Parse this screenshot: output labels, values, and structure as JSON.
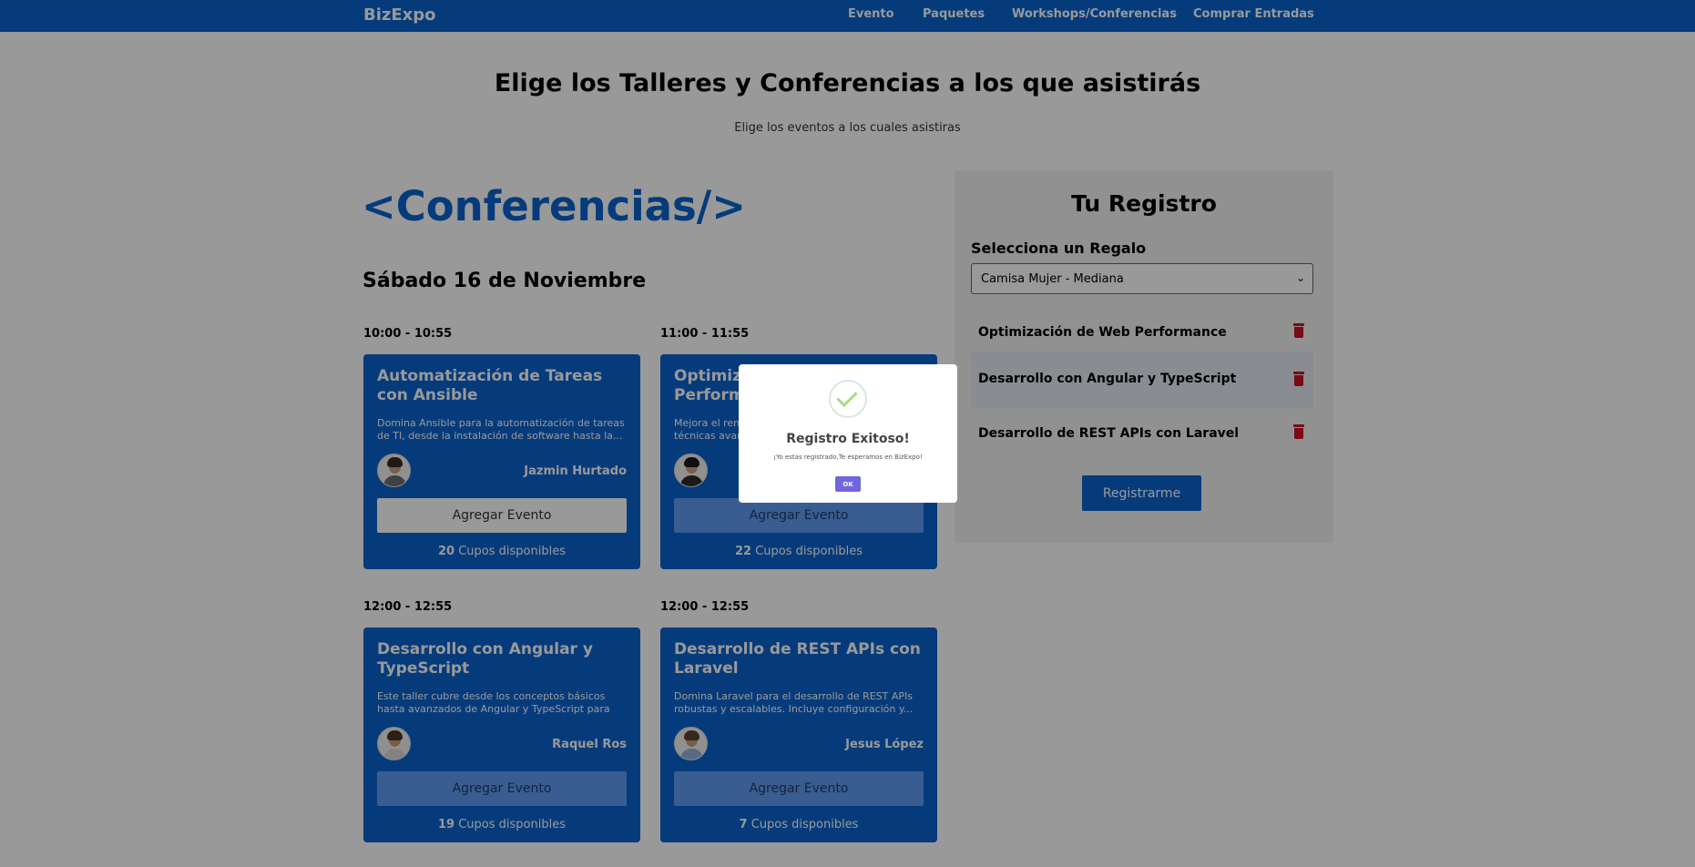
{
  "header": {
    "logo": "BizExpo",
    "nav": [
      "Evento",
      "Paquetes",
      "Workshops/Conferencias",
      "Comprar Entradas"
    ]
  },
  "page": {
    "title": "Elige los Talleres y Conferencias a los que asistirás",
    "subtitle": "Elige los eventos a los cuales asistiras"
  },
  "section": {
    "title": "<Conferencias/>",
    "day": "Sábado 16 de Noviembre"
  },
  "events": [
    {
      "time": "10:00 - 10:55",
      "title": "Automatización de Tareas con Ansible",
      "description": "Domina Ansible para la automatización de tareas de TI, desde la instalación de software hasta la...",
      "speaker": "Jazmin Hurtado",
      "button": "Agregar Evento",
      "slots": "20",
      "slots_label": "Cupos disponibles"
    },
    {
      "time": "11:00 - 11:55",
      "title": "Optimización de Web Performance",
      "description": "Mejora el rendimiento de tus sitios web con técnicas avanzadas de...",
      "speaker": "",
      "button": "Agregar Evento",
      "slots": "22",
      "slots_label": "Cupos disponibles"
    },
    {
      "time": "12:00 - 12:55",
      "title": "Desarrollo con Angular y TypeScript",
      "description": "Este taller cubre desde los conceptos básicos hasta avanzados de Angular y TypeScript para construir...",
      "speaker": "Raquel Ros",
      "button": "Agregar Evento",
      "slots": "19",
      "slots_label": "Cupos disponibles"
    },
    {
      "time": "12:00 - 12:55",
      "title": "Desarrollo de REST APIs con Laravel",
      "description": "Domina Laravel para el desarrollo de REST APIs robustas y escalables. Incluye configuración y...",
      "speaker": "Jesus López",
      "button": "Agregar Evento",
      "slots": "7",
      "slots_label": "Cupos disponibles"
    }
  ],
  "registro": {
    "title": "Tu Registro",
    "gift_label": "Selecciona un Regalo",
    "gift_selected": "Camisa Mujer - Mediana",
    "items": [
      "Optimización de Web Performance",
      "Desarrollo con Angular y TypeScript",
      "Desarrollo de REST APIs con Laravel"
    ],
    "button": "Registrarme"
  },
  "modal": {
    "title": "Registro Exitoso!",
    "text": "¡Yo estas registrado,Te esperamos en BizExpo!",
    "ok": "OK"
  }
}
